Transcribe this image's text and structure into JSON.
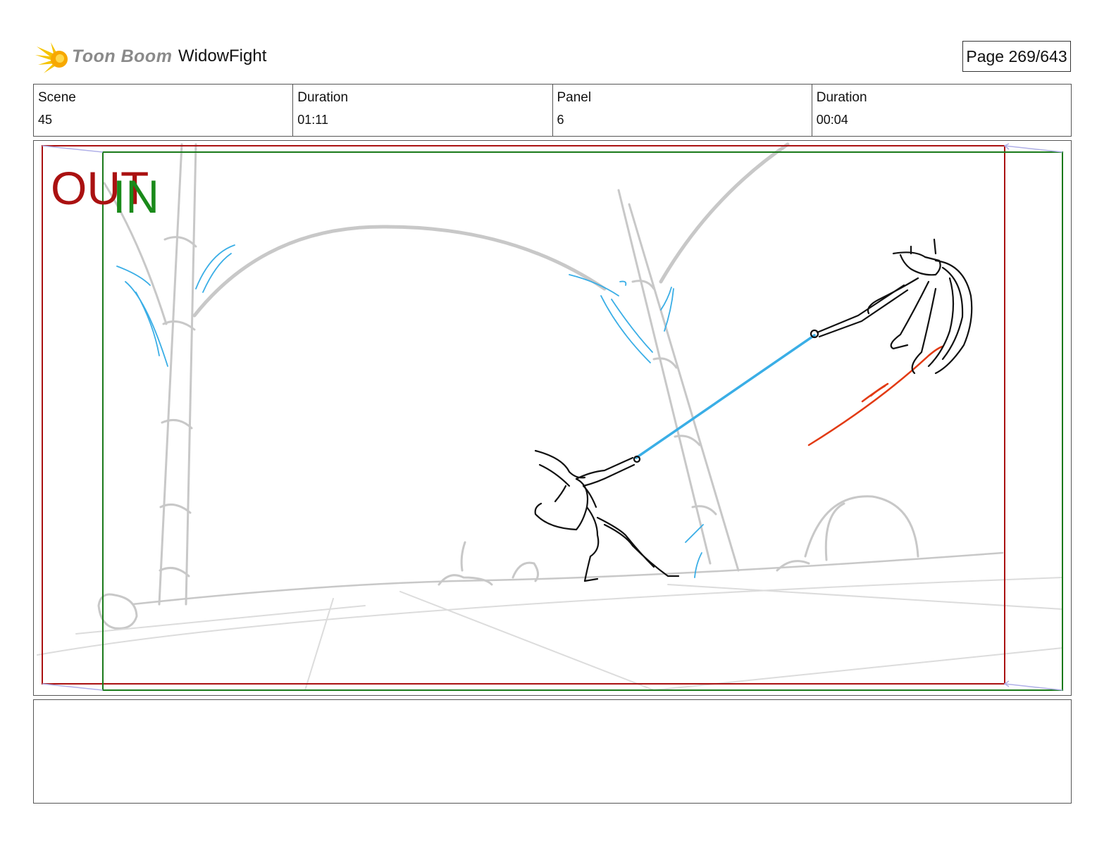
{
  "header": {
    "logo_text": "Toon Boom",
    "project_title": "WidowFight",
    "page_label": "Page 269/643"
  },
  "info": {
    "scene_label": "Scene",
    "scene_value": "45",
    "scene_duration_label": "Duration",
    "scene_duration_value": "01:11",
    "panel_label": "Panel",
    "panel_value": "6",
    "panel_duration_label": "Duration",
    "panel_duration_value": "00:04"
  },
  "panel": {
    "out_label": "OUT",
    "in_label": "IN",
    "out_color": "#aa1111",
    "in_color": "#1a8a1a",
    "rope_color": "#3aaee6",
    "motion_color": "#e23a12"
  },
  "notes": {
    "text": ""
  }
}
